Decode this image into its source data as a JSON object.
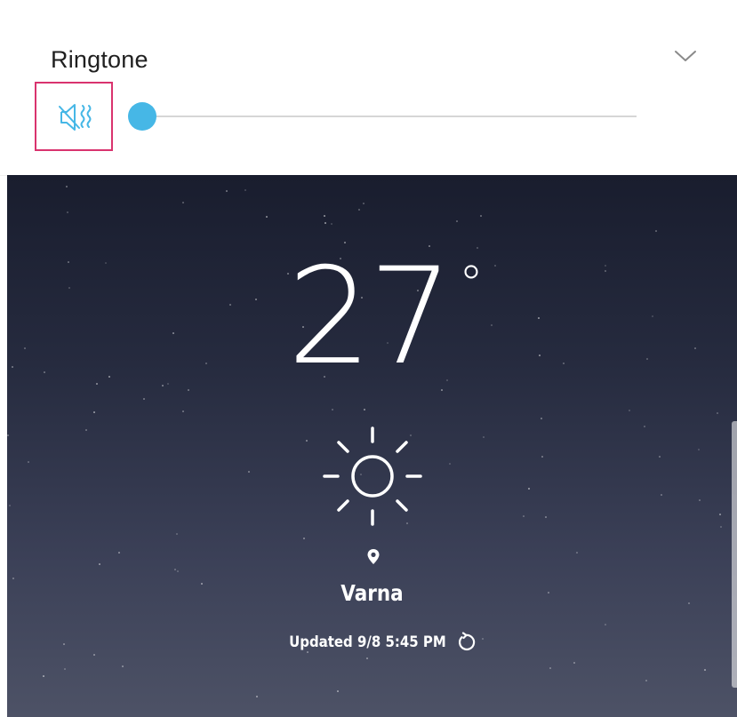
{
  "volume_panel": {
    "title": "Ringtone",
    "mute_icon": "speaker-mute-vibrate-icon",
    "expand_icon": "chevron-down-icon",
    "ringtone_level": 0,
    "accent_color": "#46b7e6",
    "highlight_color": "#d9336e"
  },
  "weather": {
    "temperature": "27",
    "degree_symbol": "°",
    "condition_icon": "sun-icon",
    "location_icon": "location-pin-icon",
    "city": "Varna",
    "updated": "Updated 9/8 5:45 PM",
    "refresh_icon": "refresh-icon"
  }
}
